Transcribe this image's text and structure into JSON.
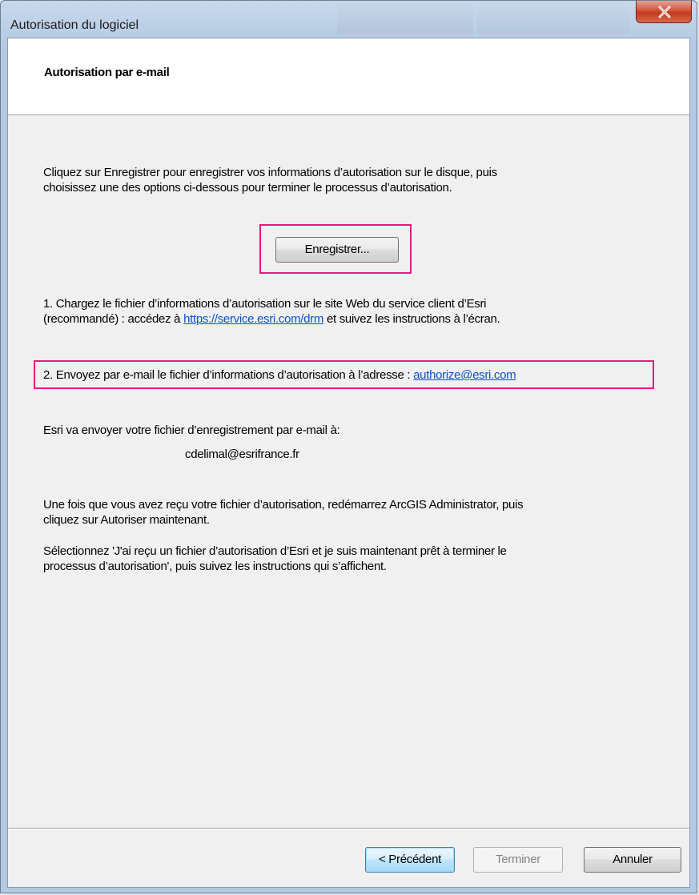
{
  "window": {
    "title": "Autorisation du logiciel"
  },
  "header": {
    "title": "Autorisation par e-mail"
  },
  "intro": {
    "line1": "Cliquez sur Enregistrer pour enregistrer vos informations d’autorisation sur le disque, puis",
    "line2": "choisissez une des options ci-dessous pour terminer le processus d’autorisation."
  },
  "save_button": {
    "label": "Enregistrer..."
  },
  "option1": {
    "line1": "1. Chargez le fichier d’informations d’autorisation sur le site Web du service client d’Esri",
    "line2_prefix": "(recommandé) : accédez à ",
    "link": "https://service.esri.com/drm",
    "line2_suffix": " et suivez les instructions à l’écran."
  },
  "option2": {
    "prefix": "2. Envoyez par e-mail le fichier d’informations d’autorisation à l’adresse : ",
    "link": "authorize@esri.com"
  },
  "send_info": {
    "label": "Esri va envoyer votre fichier d’enregistrement par e-mail à:",
    "email": "cdelimal@esrifrance.fr"
  },
  "after_receipt": {
    "line1": "Une fois que vous avez reçu votre fichier d’autorisation, redémarrez ArcGIS Administrator, puis",
    "line2": "cliquez sur Autoriser maintenant."
  },
  "select_instruction": {
    "line1": "Sélectionnez 'J'ai reçu un fichier d’autorisation d’Esri et je suis maintenant prêt à terminer le",
    "line2": "processus d’autorisation', puis suivez les instructions qui s’affichent."
  },
  "footer": {
    "back_label": "< Précédent",
    "finish_label": "Terminer",
    "cancel_label": "Annuler"
  },
  "colors": {
    "highlight": "#e8197c",
    "link": "#0b52c9",
    "close_button": "#c3391f"
  },
  "icons": {
    "close": "close-icon"
  }
}
